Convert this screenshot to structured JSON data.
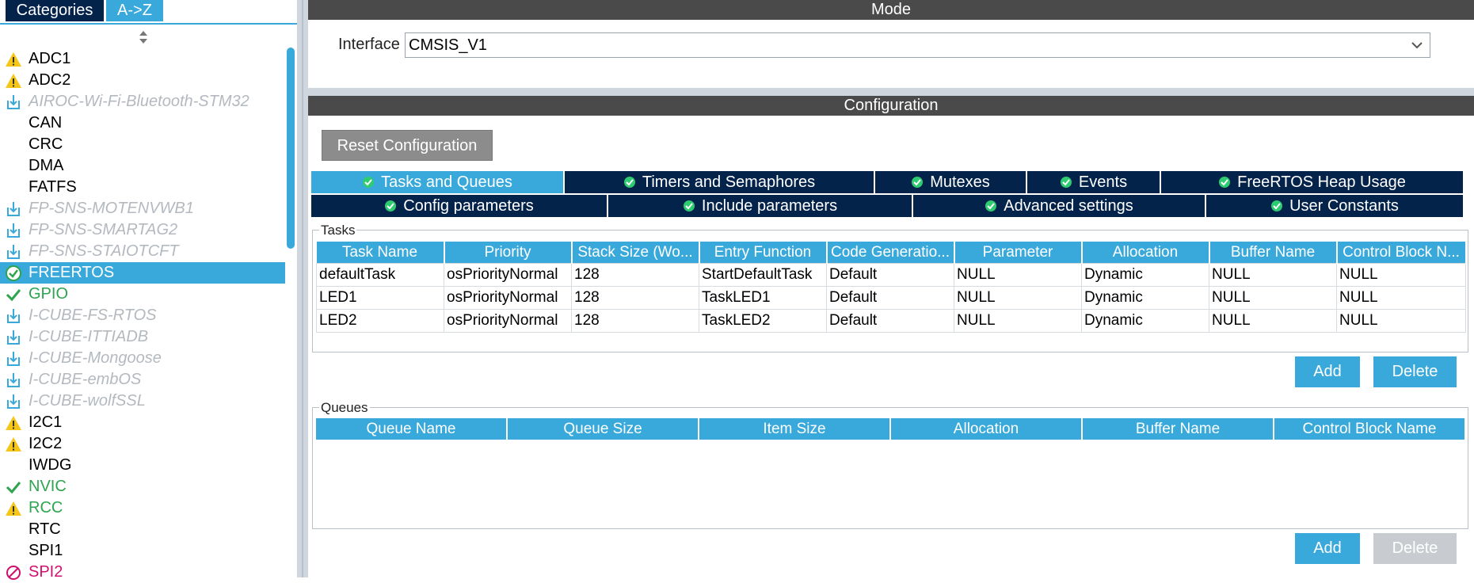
{
  "left_panel": {
    "tabs": {
      "categories": "Categories",
      "az": "A->Z"
    },
    "peripherals": [
      {
        "label": "ADC1",
        "icon": "warning-icon",
        "style": "normal"
      },
      {
        "label": "ADC2",
        "icon": "warning-icon",
        "style": "normal"
      },
      {
        "label": "AIROC-Wi-Fi-Bluetooth-STM32",
        "icon": "download-icon",
        "style": "dl"
      },
      {
        "label": "CAN",
        "icon": "",
        "style": "normal"
      },
      {
        "label": "CRC",
        "icon": "",
        "style": "normal"
      },
      {
        "label": "DMA",
        "icon": "",
        "style": "normal"
      },
      {
        "label": "FATFS",
        "icon": "",
        "style": "normal"
      },
      {
        "label": "FP-SNS-MOTENVWB1",
        "icon": "download-icon",
        "style": "dl"
      },
      {
        "label": "FP-SNS-SMARTAG2",
        "icon": "download-icon",
        "style": "dl"
      },
      {
        "label": "FP-SNS-STAIOTCFT",
        "icon": "download-icon",
        "style": "dl"
      },
      {
        "label": "FREERTOS",
        "icon": "check-circle-icon",
        "style": "selected"
      },
      {
        "label": "GPIO",
        "icon": "check-icon",
        "style": "green"
      },
      {
        "label": "I-CUBE-FS-RTOS",
        "icon": "download-icon",
        "style": "dl"
      },
      {
        "label": "I-CUBE-ITTIADB",
        "icon": "download-icon",
        "style": "dl"
      },
      {
        "label": "I-CUBE-Mongoose",
        "icon": "download-icon",
        "style": "dl"
      },
      {
        "label": "I-CUBE-embOS",
        "icon": "download-icon",
        "style": "dl"
      },
      {
        "label": "I-CUBE-wolfSSL",
        "icon": "download-icon",
        "style": "dl"
      },
      {
        "label": "I2C1",
        "icon": "warning-icon",
        "style": "normal"
      },
      {
        "label": "I2C2",
        "icon": "warning-icon",
        "style": "normal"
      },
      {
        "label": "IWDG",
        "icon": "",
        "style": "normal"
      },
      {
        "label": "NVIC",
        "icon": "check-icon",
        "style": "green"
      },
      {
        "label": "RCC",
        "icon": "warning-icon",
        "style": "green"
      },
      {
        "label": "RTC",
        "icon": "",
        "style": "normal"
      },
      {
        "label": "SPI1",
        "icon": "",
        "style": "normal"
      },
      {
        "label": "SPI2",
        "icon": "disabled-icon",
        "style": "pink"
      }
    ]
  },
  "mode": {
    "title": "Mode",
    "interface_label": "Interface",
    "interface_value": "CMSIS_V1"
  },
  "configuration": {
    "title": "Configuration",
    "reset_button": "Reset Configuration",
    "tabs_row1": [
      {
        "label": "Tasks and Queues",
        "active": true
      },
      {
        "label": "Timers and Semaphores",
        "active": false
      },
      {
        "label": "Mutexes",
        "active": false
      },
      {
        "label": "Events",
        "active": false
      },
      {
        "label": "FreeRTOS Heap Usage",
        "active": false
      }
    ],
    "tabs_row2": [
      {
        "label": "Config parameters",
        "active": false
      },
      {
        "label": "Include parameters",
        "active": false
      },
      {
        "label": "Advanced settings",
        "active": false
      },
      {
        "label": "User Constants",
        "active": false
      }
    ],
    "tasks": {
      "legend": "Tasks",
      "columns": [
        "Task Name",
        "Priority",
        "Stack Size (Wo...",
        "Entry Function",
        "Code Generatio...",
        "Parameter",
        "Allocation",
        "Buffer Name",
        "Control Block N..."
      ],
      "rows": [
        [
          "defaultTask",
          "osPriorityNormal",
          "128",
          "StartDefaultTask",
          "Default",
          "NULL",
          "Dynamic",
          "NULL",
          "NULL"
        ],
        [
          "LED1",
          "osPriorityNormal",
          "128",
          "TaskLED1",
          "Default",
          "NULL",
          "Dynamic",
          "NULL",
          "NULL"
        ],
        [
          "LED2",
          "osPriorityNormal",
          "128",
          "TaskLED2",
          "Default",
          "NULL",
          "Dynamic",
          "NULL",
          "NULL"
        ]
      ],
      "add_label": "Add",
      "delete_label": "Delete"
    },
    "queues": {
      "legend": "Queues",
      "columns": [
        "Queue Name",
        "Queue Size",
        "Item Size",
        "Allocation",
        "Buffer Name",
        "Control Block Name"
      ],
      "rows": [],
      "add_label": "Add",
      "delete_label": "Delete"
    }
  },
  "colors": {
    "accent": "#39a9db",
    "navy": "#03234b",
    "title_bar": "#4a4a4a",
    "warning": "#f5c518",
    "ok_green": "#2ea44f",
    "error_pink": "#d0106e"
  }
}
